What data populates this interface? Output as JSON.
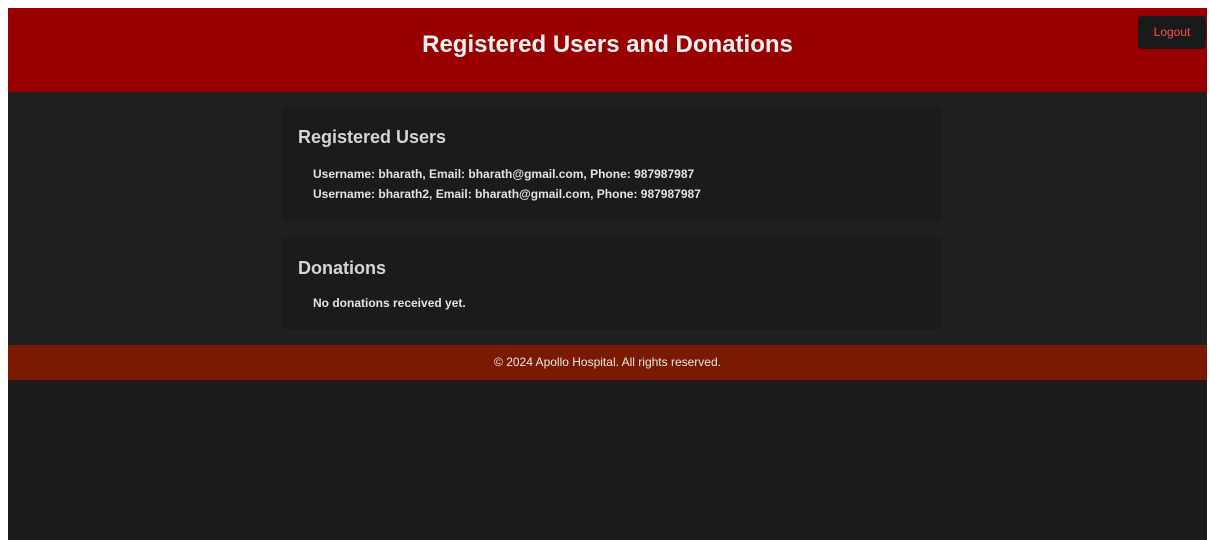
{
  "header": {
    "title": "Registered Users and Donations",
    "logout_label": "Logout"
  },
  "users_section": {
    "title": "Registered Users",
    "users": [
      "Username: bharath, Email: bharath@gmail.com, Phone: 987987987",
      "Username: bharath2, Email: bharath@gmail.com, Phone: 987987987"
    ]
  },
  "donations_section": {
    "title": "Donations",
    "empty_message": "No donations received yet."
  },
  "footer": {
    "text": "© 2024 Apollo Hospital. All rights reserved."
  },
  "colors": {
    "header_bg": "#990000",
    "main_bg": "#1f2121",
    "card_bg": "#1b1b1b",
    "footer_bg": "#7a1a00",
    "logout_text": "#ff4d4d"
  }
}
